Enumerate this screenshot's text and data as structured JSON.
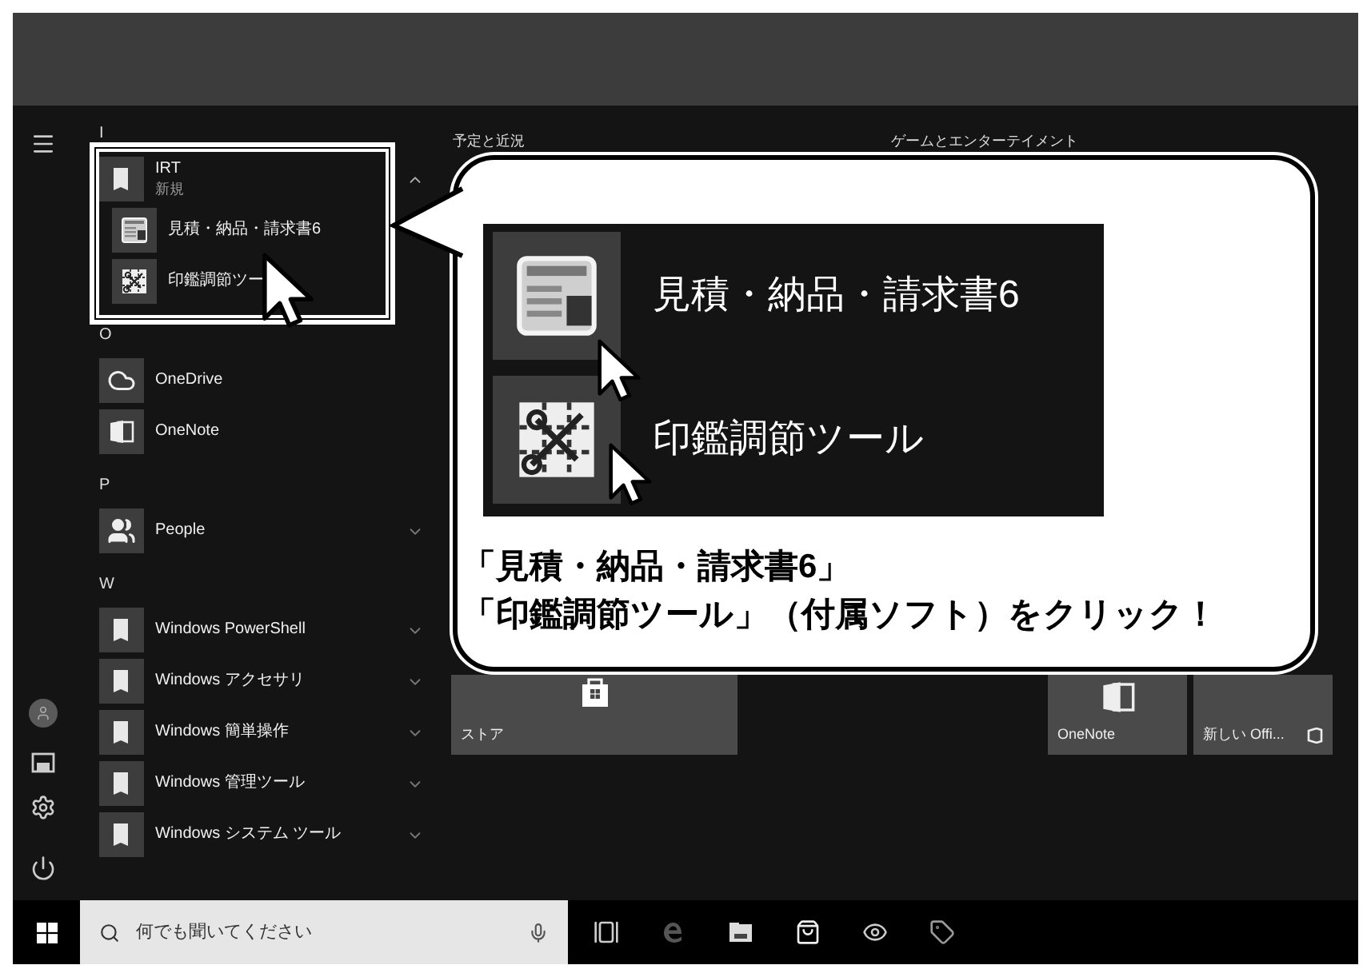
{
  "start_menu": {
    "app_groups": [
      {
        "letter": "I",
        "items": [
          {
            "kind": "folder",
            "name": "IRT",
            "subtitle": "新規",
            "expanded": true,
            "children": [
              {
                "name": "見積・納品・請求書6"
              },
              {
                "name": "印鑑調節ツー"
              }
            ]
          }
        ]
      },
      {
        "letter": "O",
        "items": [
          {
            "kind": "app",
            "name": "OneDrive"
          },
          {
            "kind": "app",
            "name": "OneNote"
          }
        ]
      },
      {
        "letter": "P",
        "items": [
          {
            "kind": "folder",
            "name": "People",
            "expanded": false
          }
        ]
      },
      {
        "letter": "W",
        "items": [
          {
            "kind": "folder",
            "name": "Windows PowerShell",
            "expanded": false
          },
          {
            "kind": "folder",
            "name": "Windows アクセサリ",
            "expanded": false
          },
          {
            "kind": "folder",
            "name": "Windows 簡単操作",
            "expanded": false
          },
          {
            "kind": "folder",
            "name": "Windows 管理ツール",
            "expanded": false
          },
          {
            "kind": "folder",
            "name": "Windows システム ツール",
            "expanded": false
          }
        ]
      }
    ],
    "tile_groups": [
      {
        "title": "予定と近況"
      },
      {
        "title": "ゲームとエンターテイメント"
      }
    ],
    "tiles": [
      {
        "label": "ストア"
      },
      {
        "label": "OneNote"
      },
      {
        "label": "新しい Offi..."
      }
    ]
  },
  "callout": {
    "items": [
      {
        "label": "見積・納品・請求書6"
      },
      {
        "label": "印鑑調節ツール"
      }
    ],
    "message": [
      "「見積・納品・請求書6」",
      "「印鑑調節ツール」（付属ソフト）をクリック！"
    ]
  },
  "taskbar": {
    "search": {
      "placeholder": "何でも聞いてください"
    }
  }
}
